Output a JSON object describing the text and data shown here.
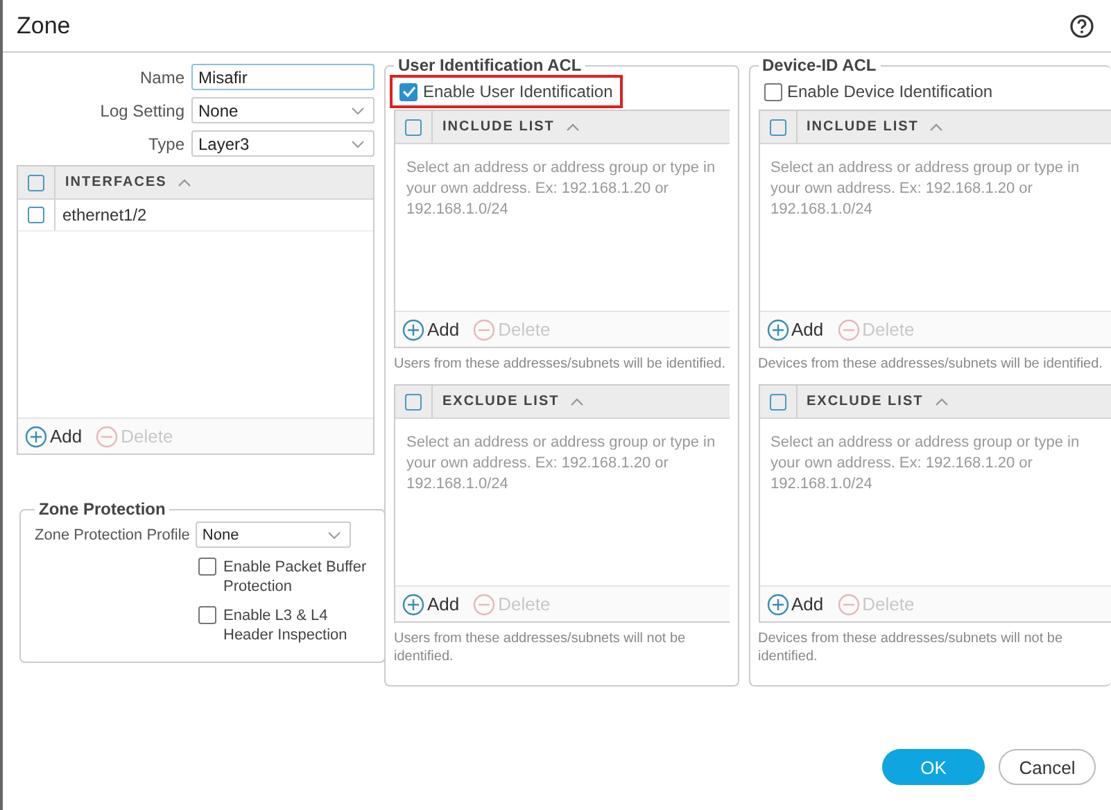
{
  "window": {
    "title": "Zone"
  },
  "form": {
    "fields": [
      {
        "label": "Name",
        "kind": "text",
        "value": "Misafir"
      },
      {
        "label": "Log Setting",
        "kind": "select",
        "value": "None"
      },
      {
        "label": "Type",
        "kind": "select",
        "value": "Layer3"
      }
    ]
  },
  "interfaces": {
    "header": "INTERFACES",
    "select_all_checked": false,
    "rows": [
      {
        "name": "ethernet1/2",
        "checked": false
      }
    ],
    "actions": [
      {
        "label": "Add",
        "kind": "add",
        "disabled": false
      },
      {
        "label": "Delete",
        "kind": "delete",
        "disabled": true
      }
    ]
  },
  "zone_protection": {
    "title": "Zone Protection",
    "profile_label": "Zone Protection Profile",
    "profile_value": "None",
    "checkboxes": [
      {
        "label": "Enable Packet Buffer Protection",
        "checked": false
      },
      {
        "label": "Enable L3 & L4 Header Inspection",
        "checked": false
      }
    ]
  },
  "acl_panels": [
    {
      "title": "User Identification ACL",
      "enable": {
        "label": "Enable User Identification",
        "checked": true,
        "highlighted": true
      },
      "lists": [
        {
          "header": "INCLUDE LIST",
          "select_all_checked": false,
          "placeholder": "Select an address or address group or type in your own address. Ex: 192.168.1.20 or 192.168.1.0/24",
          "actions": [
            {
              "label": "Add",
              "kind": "add",
              "disabled": false
            },
            {
              "label": "Delete",
              "kind": "delete",
              "disabled": true
            }
          ],
          "note": "Users from these addresses/subnets will be identified."
        },
        {
          "header": "EXCLUDE LIST",
          "select_all_checked": false,
          "placeholder": "Select an address or address group or type in your own address. Ex: 192.168.1.20 or 192.168.1.0/24",
          "actions": [
            {
              "label": "Add",
              "kind": "add",
              "disabled": false
            },
            {
              "label": "Delete",
              "kind": "delete",
              "disabled": true
            }
          ],
          "note": "Users from these addresses/subnets will not be identified."
        }
      ]
    },
    {
      "title": "Device-ID ACL",
      "enable": {
        "label": "Enable Device Identification",
        "checked": false,
        "highlighted": false
      },
      "lists": [
        {
          "header": "INCLUDE LIST",
          "select_all_checked": false,
          "placeholder": "Select an address or address group or type in your own address. Ex: 192.168.1.20 or 192.168.1.0/24",
          "actions": [
            {
              "label": "Add",
              "kind": "add",
              "disabled": false
            },
            {
              "label": "Delete",
              "kind": "delete",
              "disabled": true
            }
          ],
          "note": "Devices from these addresses/subnets will be identified."
        },
        {
          "header": "EXCLUDE LIST",
          "select_all_checked": false,
          "placeholder": "Select an address or address group or type in your own address. Ex: 192.168.1.20 or 192.168.1.0/24",
          "actions": [
            {
              "label": "Add",
              "kind": "add",
              "disabled": false
            },
            {
              "label": "Delete",
              "kind": "delete",
              "disabled": true
            }
          ],
          "note": "Devices from these addresses/subnets will not be identified."
        }
      ]
    }
  ],
  "buttons": [
    {
      "label": "OK",
      "kind": "primary"
    },
    {
      "label": "Cancel",
      "kind": "secondary"
    }
  ]
}
